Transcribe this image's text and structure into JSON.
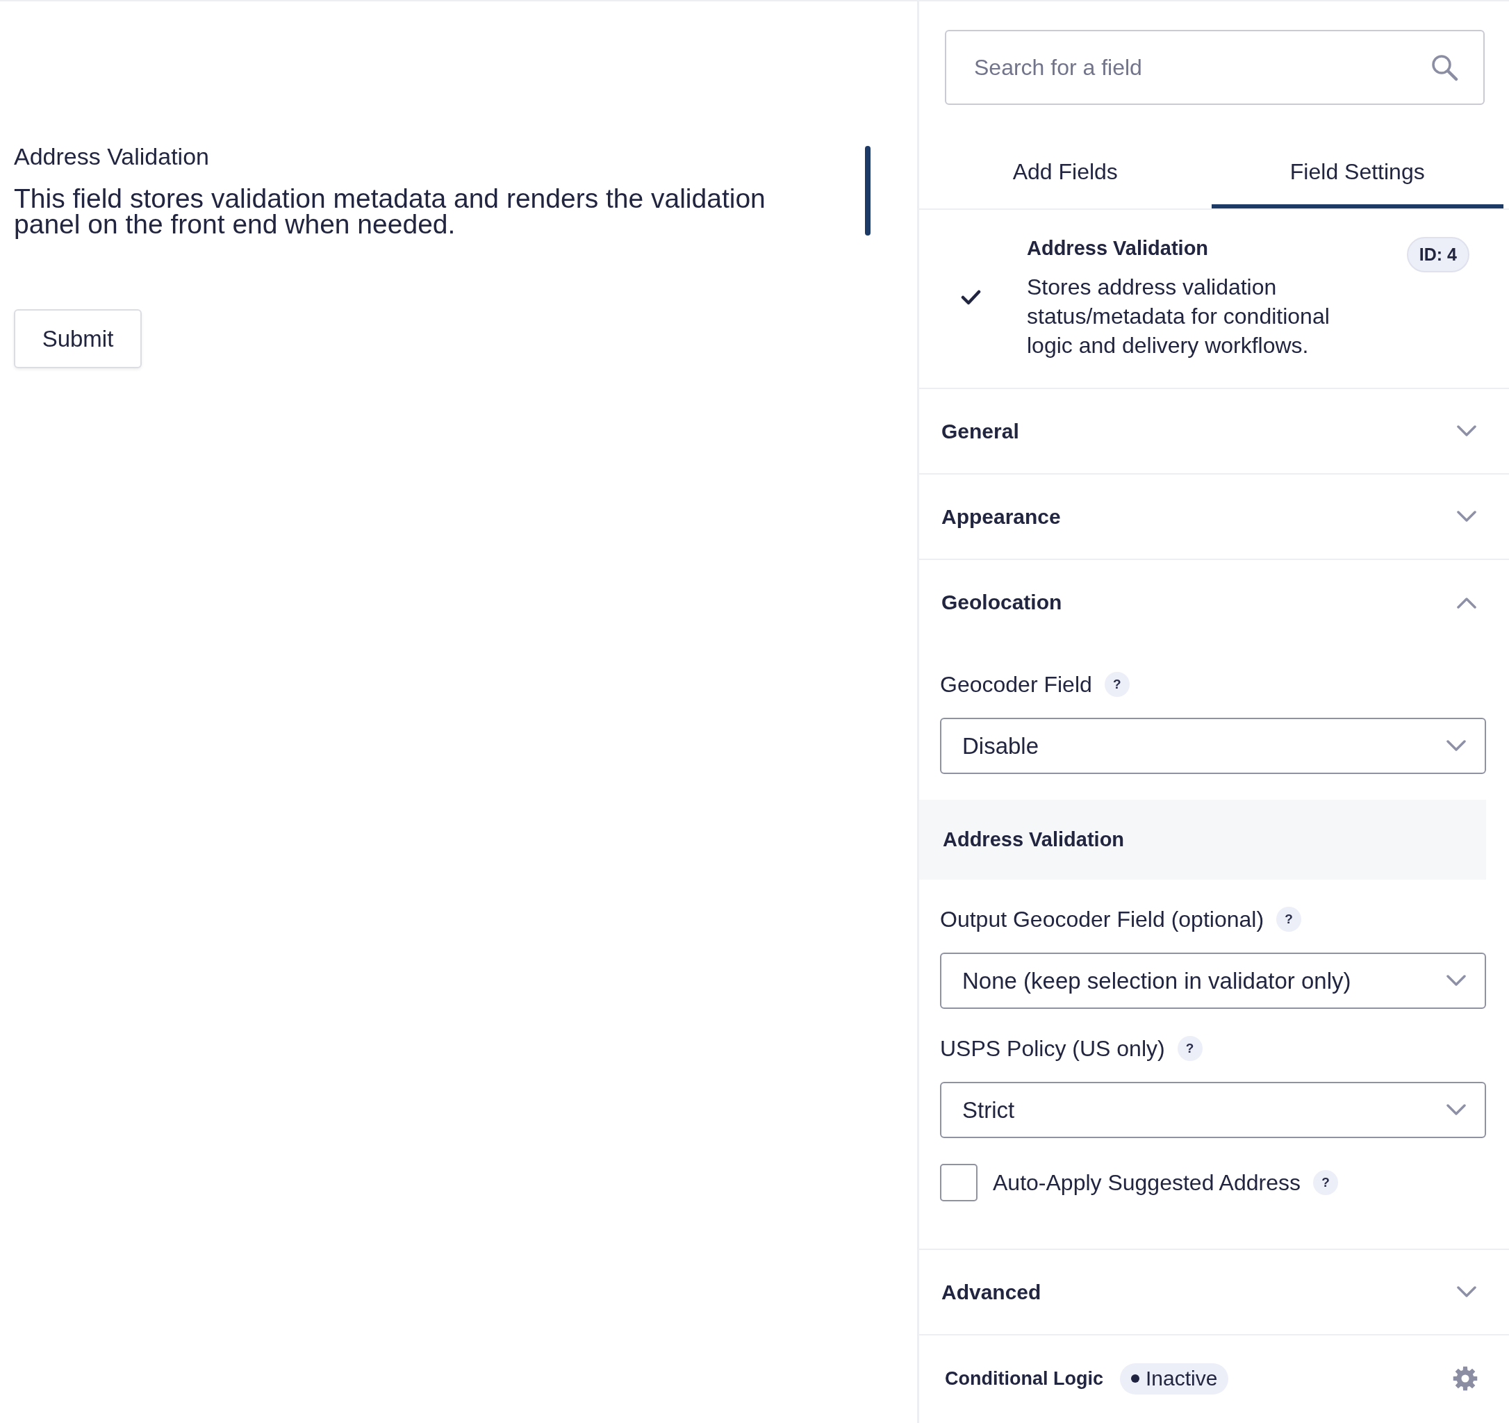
{
  "form_preview": {
    "field": {
      "label": "Address Validation",
      "description": "This field stores validation metadata and renders the validation panel on the front end when needed.",
      "selected": true
    },
    "submit_button": "Submit"
  },
  "sidebar": {
    "search": {
      "placeholder": "Search for a field"
    },
    "tabs": [
      {
        "label": "Add Fields",
        "selected": false
      },
      {
        "label": "Field Settings",
        "selected": true
      }
    ],
    "field_card": {
      "title": "Address Validation",
      "description": "Stores address validation status/metadata for conditional logic and delivery workflows.",
      "badge": "ID: 4"
    },
    "sections": [
      {
        "title": "General",
        "expanded": false
      },
      {
        "title": "Appearance",
        "expanded": false
      },
      {
        "title": "Geolocation",
        "expanded": true,
        "settings": [
          {
            "kind": "select",
            "label": "Geocoder Field",
            "help": "?",
            "value": "Disable"
          },
          {
            "kind": "heading",
            "label": "Address Validation"
          },
          {
            "kind": "select",
            "label": "Output Geocoder Field (optional)",
            "help": "?",
            "value": "None (keep selection in validator only)"
          },
          {
            "kind": "select",
            "label": "USPS Policy (US only)",
            "help": "?",
            "value": "Strict"
          },
          {
            "kind": "checkbox",
            "label": "Auto-Apply Suggested Address",
            "help": "?",
            "checked": false
          }
        ]
      },
      {
        "title": "Advanced",
        "expanded": false
      }
    ],
    "conditional_logic": {
      "title": "Conditional Logic",
      "status": "Inactive"
    }
  }
}
